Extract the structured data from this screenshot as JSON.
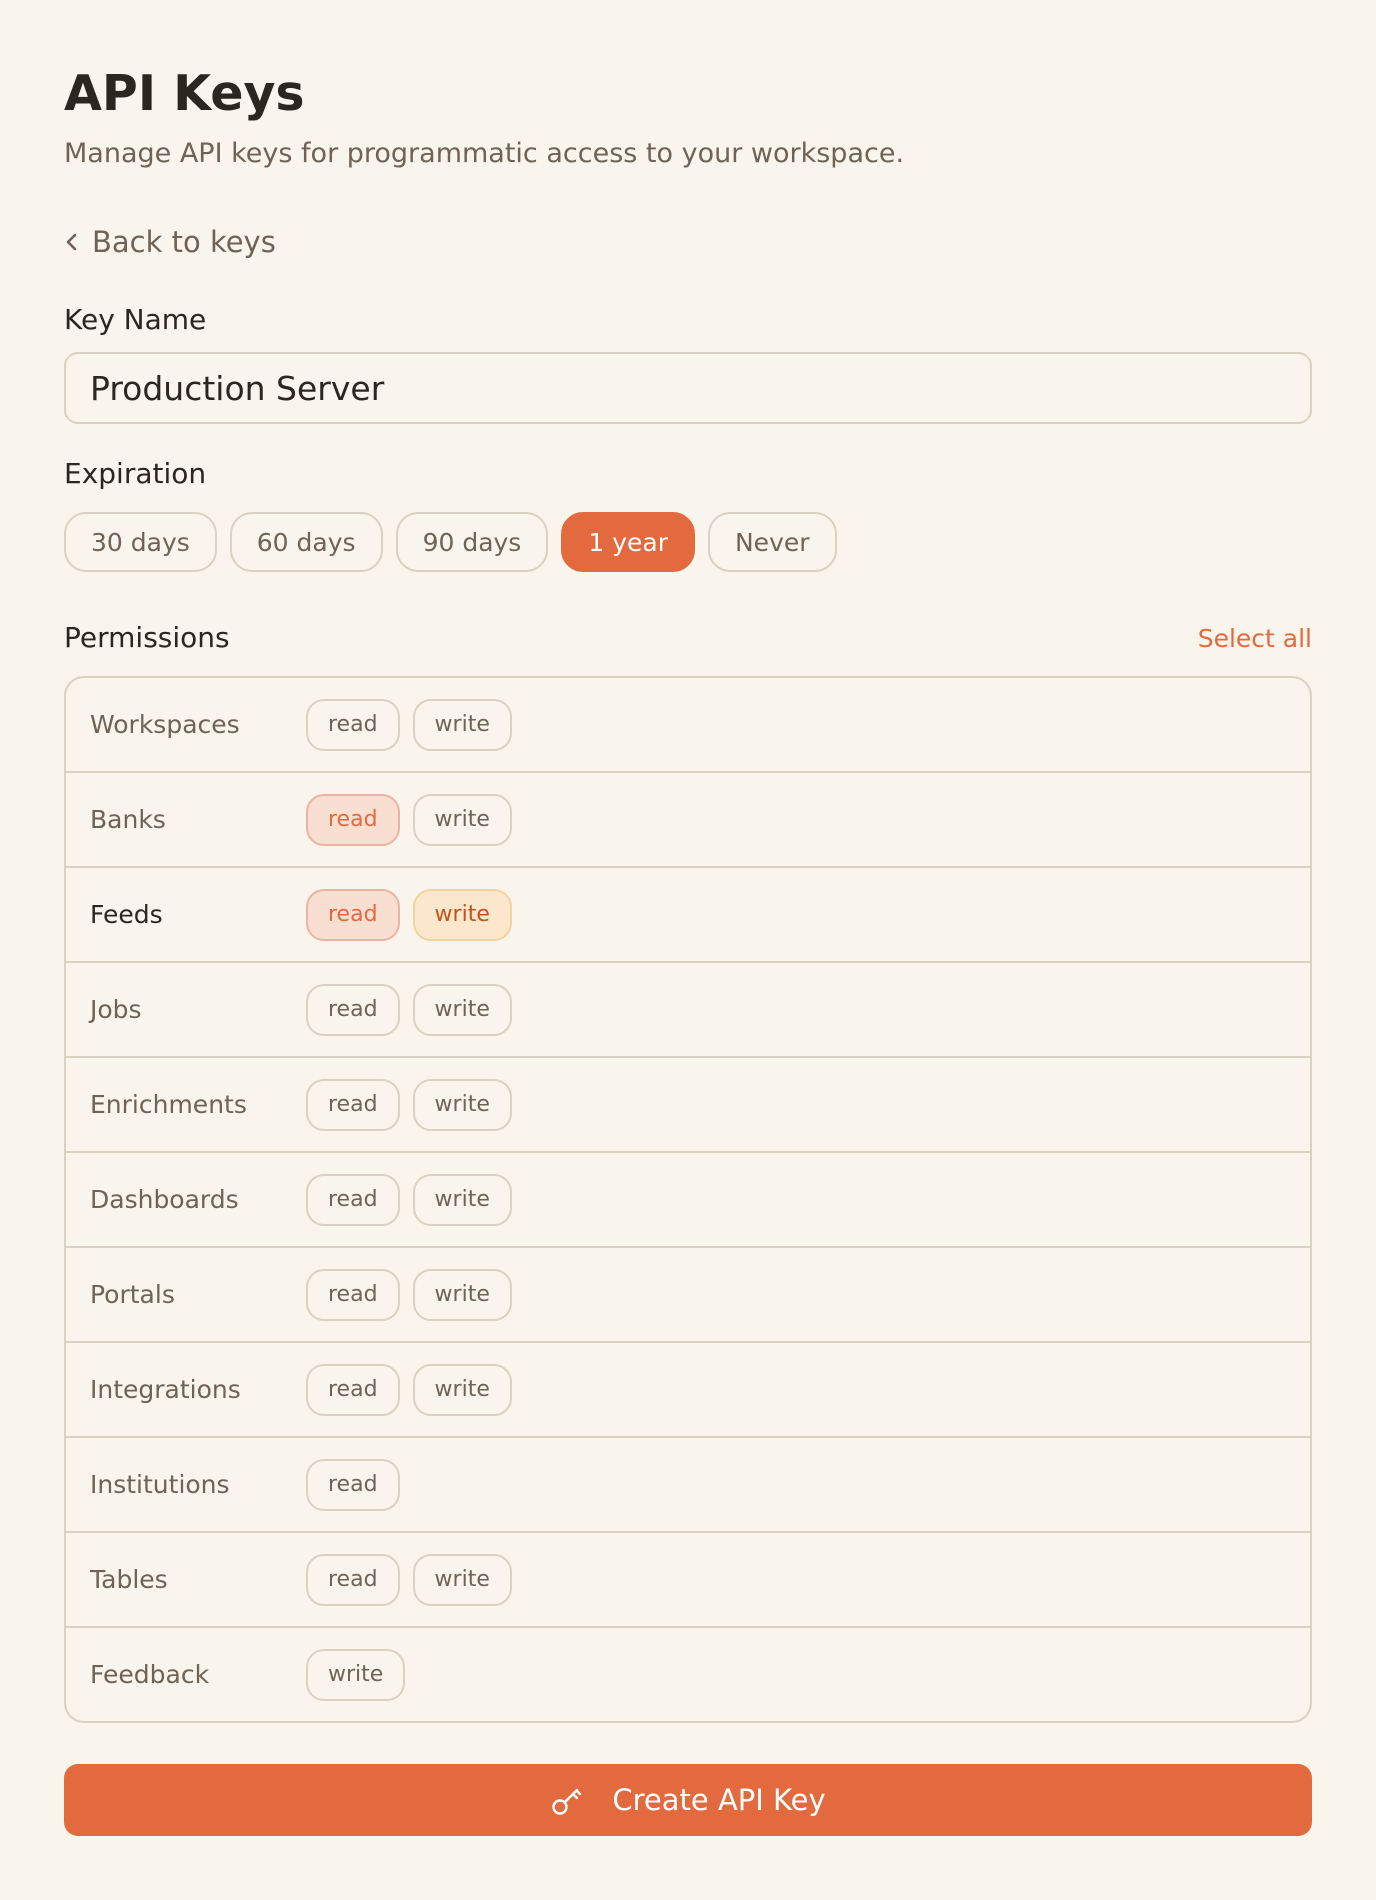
{
  "header": {
    "title": "API Keys",
    "subtitle": "Manage API keys for programmatic access to your workspace."
  },
  "back_link": {
    "label": "Back to keys",
    "icon": "chevron-left-icon"
  },
  "key_name": {
    "label": "Key Name",
    "value": "Production Server"
  },
  "expiration": {
    "label": "Expiration",
    "selected": "1 year",
    "options": [
      "30 days",
      "60 days",
      "90 days",
      "1 year",
      "Never"
    ]
  },
  "permissions": {
    "label": "Permissions",
    "select_all_label": "Select all",
    "rows": [
      {
        "name": "Workspaces",
        "scopes": [
          {
            "label": "read",
            "selected": false
          },
          {
            "label": "write",
            "selected": false
          }
        ]
      },
      {
        "name": "Banks",
        "scopes": [
          {
            "label": "read",
            "selected": true
          },
          {
            "label": "write",
            "selected": false
          }
        ]
      },
      {
        "name": "Feeds",
        "scopes": [
          {
            "label": "read",
            "selected": true
          },
          {
            "label": "write",
            "selected": true
          }
        ]
      },
      {
        "name": "Jobs",
        "scopes": [
          {
            "label": "read",
            "selected": false
          },
          {
            "label": "write",
            "selected": false
          }
        ]
      },
      {
        "name": "Enrichments",
        "scopes": [
          {
            "label": "read",
            "selected": false
          },
          {
            "label": "write",
            "selected": false
          }
        ]
      },
      {
        "name": "Dashboards",
        "scopes": [
          {
            "label": "read",
            "selected": false
          },
          {
            "label": "write",
            "selected": false
          }
        ]
      },
      {
        "name": "Portals",
        "scopes": [
          {
            "label": "read",
            "selected": false
          },
          {
            "label": "write",
            "selected": false
          }
        ]
      },
      {
        "name": "Integrations",
        "scopes": [
          {
            "label": "read",
            "selected": false
          },
          {
            "label": "write",
            "selected": false
          }
        ]
      },
      {
        "name": "Institutions",
        "scopes": [
          {
            "label": "read",
            "selected": false
          }
        ]
      },
      {
        "name": "Tables",
        "scopes": [
          {
            "label": "read",
            "selected": false
          },
          {
            "label": "write",
            "selected": false
          }
        ]
      },
      {
        "name": "Feedback",
        "scopes": [
          {
            "label": "write",
            "selected": false
          }
        ]
      }
    ]
  },
  "create_button": {
    "label": "Create API Key",
    "icon": "key-icon"
  },
  "colors": {
    "background": "#f9f5ec",
    "accent": "#e36a3f",
    "text": "#2c2620",
    "muted_text": "#6e6356",
    "border": "#d9d1c2",
    "read_selected_bg": "#f8dfd2",
    "write_selected_bg": "#fbe8cc"
  }
}
